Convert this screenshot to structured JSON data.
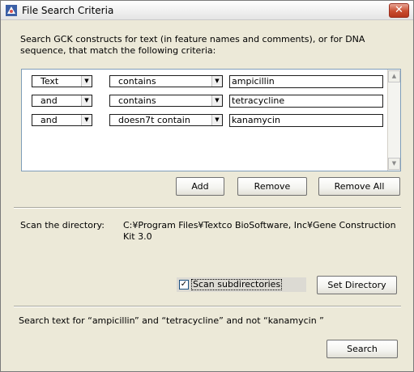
{
  "window": {
    "title": "File Search Criteria",
    "close_glyph": "✕",
    "icon": "app-icon",
    "colors": {
      "close": "#c94c2f",
      "face": "#ece9d8",
      "field_border": "#1c1c1c"
    }
  },
  "description": "Search GCK constructs for text (in feature names and comments), or for DNA sequence, that match the following criteria:",
  "criteria": [
    {
      "field": "Text",
      "operator": "contains",
      "value": "ampicillin"
    },
    {
      "field": "and",
      "operator": "contains",
      "value": "tetracycline"
    },
    {
      "field": "and",
      "operator": "doesn7t contain",
      "value": "kanamycin"
    }
  ],
  "buttons": {
    "add": "Add",
    "remove": "Remove",
    "remove_all": "Remove All",
    "set_directory": "Set Directory",
    "search": "Search"
  },
  "directory": {
    "label": "Scan the directory:",
    "path": "C:¥Program Files¥Textco BioSoftware, Inc¥Gene Construction Kit 3.0"
  },
  "subdirectories": {
    "label": "Scan subdirectories",
    "checked": true,
    "check_glyph": "✓"
  },
  "summary": "Search text  for “ampicillin” and “tetracycline” and not “kanamycin ”",
  "scroll": {
    "up_glyph": "▲",
    "down_glyph": "▼"
  },
  "dropdown_glyph": "▼"
}
